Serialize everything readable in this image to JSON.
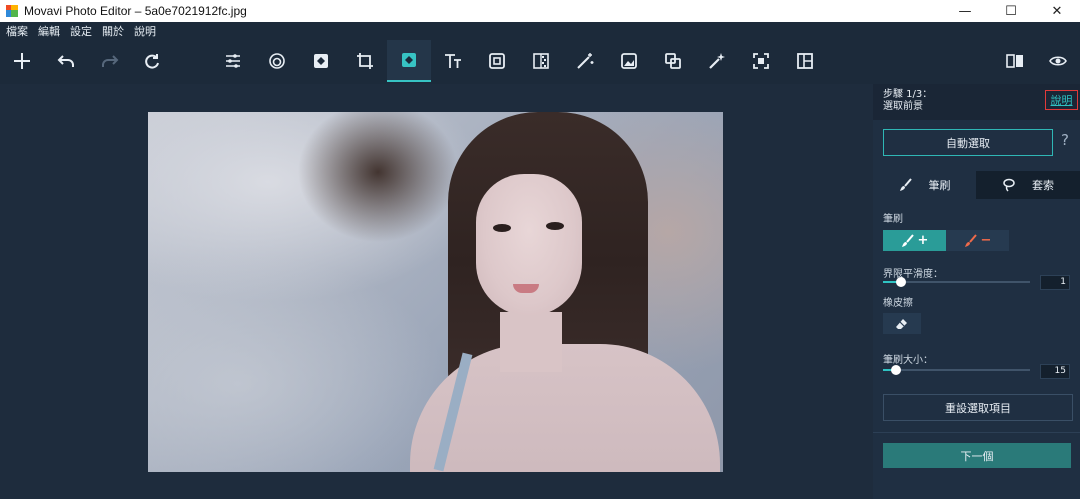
{
  "window": {
    "title": "Movavi Photo Editor – 5a0e7021912fc.jpg",
    "minimize_glyph": "—",
    "maximize_glyph": "☐",
    "close_glyph": "✕"
  },
  "menu": {
    "items": [
      "檔案",
      "編輯",
      "設定",
      "關於",
      "說明"
    ]
  },
  "toolbar": {
    "left_icons": [
      "add-icon",
      "undo-icon",
      "redo-icon",
      "rotate-icon"
    ],
    "tool_icons": [
      "adjust-icon",
      "filters-icon",
      "retouch-icon",
      "crop-icon",
      "background-removal-icon",
      "text-icon",
      "frames-icon",
      "noise-icon",
      "magic-enhance-icon",
      "replace-icon",
      "clone-icon",
      "object-removal-icon",
      "selection-icon",
      "layout-icon"
    ],
    "active_tool": "background-removal-icon",
    "right_icons": [
      "compare-icon",
      "preview-icon"
    ]
  },
  "panel": {
    "step": "步驟 1/3：",
    "step_title": "選取前景",
    "help_link": "說明",
    "auto_select": "自動選取",
    "help_question": "?",
    "tabs": {
      "brush": "筆刷",
      "lasso": "套索"
    },
    "brush_section_label": "筆刷",
    "brush_add": "+",
    "brush_remove": "−",
    "edge_smoothing_label": "界限平滑度：",
    "edge_smoothing_value": "1",
    "edge_smoothing_fraction": 0.12,
    "eraser_label": "橡皮擦",
    "brush_size_label": "筆刷大小：",
    "brush_size_value": "15",
    "brush_size_fraction": 0.09,
    "reset_selection": "重設選取項目",
    "next": "下一個"
  },
  "colors": {
    "accent": "#2fc3c3",
    "highlight_border": "#e03a3a",
    "next_button": "#2a7a79"
  }
}
